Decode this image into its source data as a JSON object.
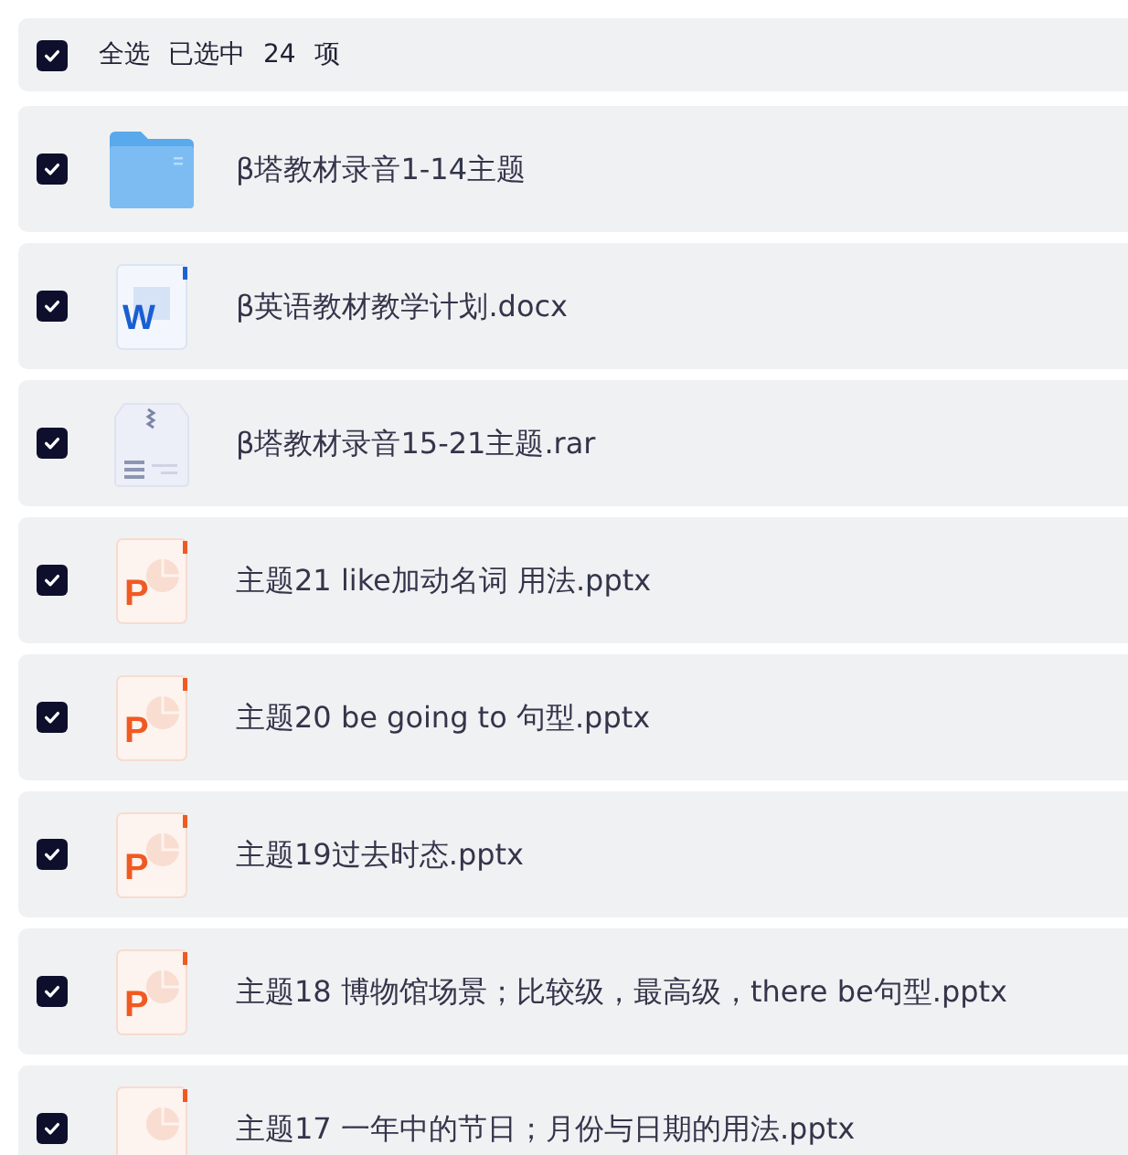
{
  "header": {
    "checked": true,
    "select_all": "全选",
    "selected_label": "已选中",
    "count": "24",
    "unit": "项"
  },
  "files": [
    {
      "kind": "folder",
      "name": "β塔教材录音1-14主题",
      "checked": true
    },
    {
      "kind": "word",
      "badge": "W",
      "name": "β英语教材教学计划.docx",
      "checked": true
    },
    {
      "kind": "archive",
      "name": "β塔教材录音15-21主题.rar",
      "checked": true
    },
    {
      "kind": "ppt",
      "badge": "P",
      "name": "主题21 like加动名词 用法.pptx",
      "checked": true
    },
    {
      "kind": "ppt",
      "badge": "P",
      "name": "主题20 be going to 句型.pptx",
      "checked": true
    },
    {
      "kind": "ppt",
      "badge": "P",
      "name": "主题19过去时态.pptx",
      "checked": true
    },
    {
      "kind": "ppt",
      "badge": "P",
      "name": "主题18 博物馆场景；比较级，最高级，there be句型.pptx",
      "checked": true
    },
    {
      "kind": "ppt",
      "name": "主题17 一年中的节日；月份与日期的用法.pptx",
      "checked": true
    }
  ]
}
